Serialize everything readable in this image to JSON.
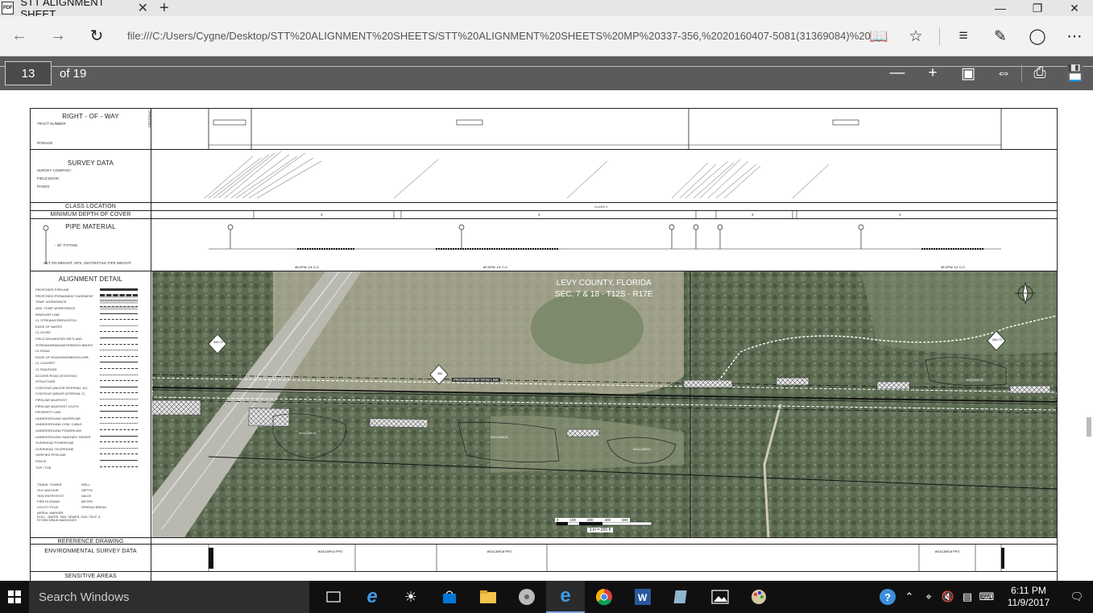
{
  "browser": {
    "tab_title": "STT ALIGNMENT SHEET",
    "pdf_badge": "PDF",
    "close_tab": "✕",
    "new_tab": "+",
    "url": "file:///C:/Users/Cygne/Desktop/STT%20ALIGNMENT%20SHEETS/STT%20ALIGNMENT%20SHEETS%20MP%20337-356,%2020160407-5081(31369084)%20(1).pdf"
  },
  "pdf_toolbar": {
    "page_number": "13",
    "page_total": "of 19"
  },
  "sheet": {
    "right_of_way": "RIGHT - OF - WAY",
    "row_tract": "TRACT NUMBER",
    "row_rodage": "RODAGE",
    "crossing": "CROSSING",
    "survey_data": "SURVEY DATA",
    "survey_company": "SURVEY COMPANY:",
    "field_book": "FIELD BOOK:",
    "pages": "PAGES:",
    "class_location": "CLASS LOCATION",
    "class_value": "CLASS 1",
    "min_depth": "MINIMUM DEPTH OF COVER",
    "depth_values": [
      "3'",
      "3'",
      "3'",
      "3'"
    ],
    "pipe_material": "PIPE MATERIAL",
    "fitting": "- 35° FITTING",
    "set_on_weight": "SET ON WEIGHT, GPS, GEOTEXTILE PIPE WEIGHT",
    "pipe_spacing": [
      "46 DFW, 14' C-C",
      "62 DFW, 14' C-C",
      "35 DFW, 14' C-C"
    ],
    "alignment_detail": "ALIGNMENT DETAIL",
    "reference_drawing": "REFERENCE DRAWING",
    "env_survey": "ENVIRONMENTAL SURVEY DATA",
    "sensitive": "SENSITIVE AREAS"
  },
  "legend": [
    "PROPOSED PIPELINE",
    "PROPOSED PERMANENT EASEMENT",
    "TEMP. WORKSPACE",
    "ADD. TEMP. WORKSPACE",
    "RAWSURF LINE",
    "CL STREAM/CREEK/DITCH",
    "EDGE OF WATER",
    "CL LEVEE",
    "FIELD DELINEATED WETLAND",
    "STREAM/DRAIN/WATERBODY BNDRY",
    "CL ROAD",
    "EDGE OF ROAD/PAVEMENT/CURB",
    "CL CULVERT",
    "CL RAILROAD",
    "ACCESS ROAD (EXISTING)",
    "STRUCTURE",
    "CONTOUR (MAJOR INTERVAL 10')",
    "CONTOUR (MINOR INTERVAL 2')",
    "PIPELINE MILEPOST",
    "PIPELINE MILEPOST 1/10TH",
    "PROPERTY LINE",
    "UNDERGROUND WATERLINE",
    "UNDERGROUND COM. CABLE",
    "UNDERGROUND POWERLINE",
    "UNDERGROUND SANITARY SEWER",
    "OVERHEAD POWERLINE",
    "OVERHEAD TELEPHONE",
    "VERIFIED PIPELINE",
    "FENCE",
    "TOP / TOE"
  ],
  "legend_symbols": [
    "TRANS. TOWER",
    "WELL",
    "GUY ANCHOR",
    "SEPTIC",
    "HDD ENTRY/EXIT",
    "VALVE",
    "PIPE IN DRAIN",
    "METER",
    "UTILITY POLE",
    "SPREAD BREAK",
    "AERIAL MARKER"
  ],
  "legend_note": "ELEC., WATER, SAN. SEWER, GAS, TELE. & STORM DRAIN MANHOLES",
  "map": {
    "county": "LEVY COUNTY, FLORIDA",
    "section": "SEC. 7 & 18 - T12S - R17E",
    "mp_left": "349.72",
    "mp_mid": "350",
    "mp_right": "350.72",
    "proposed_row": "PROPOSED 50' ROW LINE",
    "wetlands": [
      "W11CARC6",
      "W11CARC8",
      "W11CARC9",
      "W11CARC8"
    ],
    "scale_ticks": [
      "0",
      "100",
      "200",
      "400",
      "600"
    ],
    "scale_text": "1 in = 200 ft"
  },
  "env_labels": [
    "W11CARC4 PFO",
    "W11CARC8 PFO",
    "W11CARC8 PFO"
  ],
  "taskbar": {
    "search": "Search Windows",
    "time": "6:11 PM",
    "date": "11/9/2017"
  }
}
